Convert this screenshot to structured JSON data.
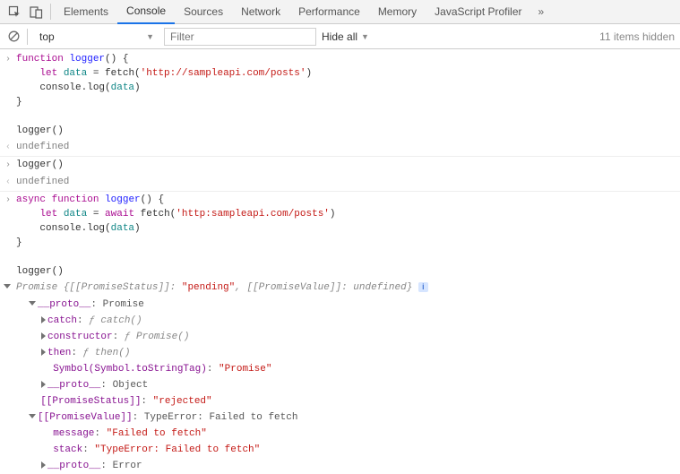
{
  "toolbar": {
    "tabs": [
      "Elements",
      "Console",
      "Sources",
      "Network",
      "Performance",
      "Memory",
      "JavaScript Profiler"
    ],
    "more": "»"
  },
  "filterbar": {
    "context": "top",
    "filter_placeholder": "Filter",
    "level": "Hide all",
    "hidden_count": "11 items hidden"
  },
  "code1": {
    "l1_a": "function",
    "l1_b": " ",
    "l1_c": "logger",
    "l1_d": "() {",
    "l2_a": "    ",
    "l2_b": "let",
    "l2_c": " ",
    "l2_d": "data",
    "l2_e": " = fetch(",
    "l2_f": "'http://sampleapi.com/posts'",
    "l2_g": ")",
    "l3_a": "    console.log(",
    "l3_b": "data",
    "l3_c": ")",
    "l4": "}",
    "blank": "",
    "call": "logger()"
  },
  "undef": "undefined",
  "call2": "logger()",
  "code2": {
    "l1_a": "async",
    "l1_b": " ",
    "l1_c": "function",
    "l1_d": " ",
    "l1_e": "logger",
    "l1_f": "() {",
    "l2_a": "    ",
    "l2_b": "let",
    "l2_c": " ",
    "l2_d": "data",
    "l2_e": " = ",
    "l2_f": "await",
    "l2_g": " fetch(",
    "l2_h": "'http:sampleapi.com/posts'",
    "l2_i": ")",
    "l3_a": "    console.log(",
    "l3_b": "data",
    "l3_c": ")",
    "l4": "}",
    "blank": "",
    "call": "logger()"
  },
  "obj": {
    "header_a": "Promise ",
    "header_b": "{",
    "header_c": "[[PromiseStatus]]: ",
    "header_d": "\"pending\"",
    "header_e": ", ",
    "header_f": "[[PromiseValue]]: ",
    "header_g": "undefined",
    "header_h": "}",
    "proto1_k": "__proto__",
    "proto1_v": ": Promise",
    "catch_k": "catch",
    "catch_v": ": ",
    "catch_f": "ƒ catch()",
    "ctor_k": "constructor",
    "ctor_v": ": ",
    "ctor_f": "ƒ Promise()",
    "then_k": "then",
    "then_v": ": ",
    "then_f": "ƒ then()",
    "sym_k": "Symbol(Symbol.toStringTag)",
    "sym_v": ": ",
    "sym_s": "\"Promise\"",
    "proto2_k": "__proto__",
    "proto2_v": ": Object",
    "ps_k": "[[PromiseStatus]]",
    "ps_v": ": ",
    "ps_s": "\"rejected\"",
    "pv_k": "[[PromiseValue]]",
    "pv_v": ": TypeError: Failed to fetch",
    "msg_k": "message",
    "msg_v": ": ",
    "msg_s": "\"Failed to fetch\"",
    "stk_k": "stack",
    "stk_v": ": ",
    "stk_s": "\"TypeError: Failed to fetch\"",
    "proto3_k": "__proto__",
    "proto3_v": ": Error"
  }
}
